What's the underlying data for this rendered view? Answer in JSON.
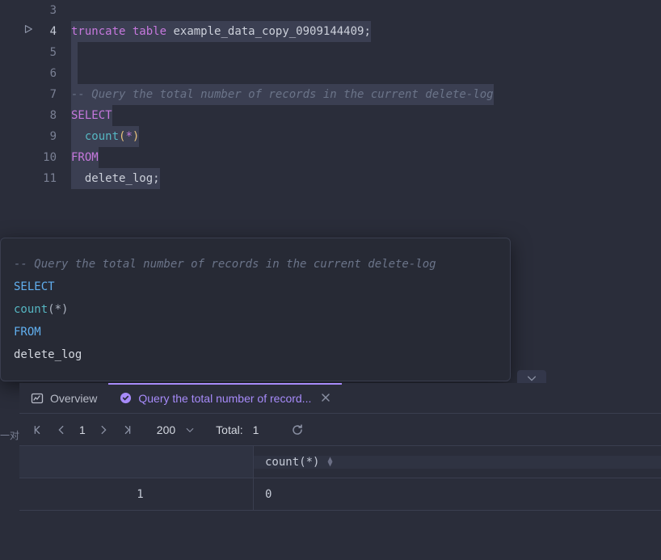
{
  "editor": {
    "lines": [
      {
        "num": "3",
        "active": false,
        "content": ""
      },
      {
        "num": "4",
        "active": true,
        "runnable": true,
        "tokens": [
          {
            "t": "truncate",
            "c": "kw"
          },
          {
            "t": " "
          },
          {
            "t": "table",
            "c": "kw"
          },
          {
            "t": " "
          },
          {
            "t": "example_data_copy_0909144409",
            "c": "ident"
          },
          {
            "t": ";",
            "c": "ident"
          }
        ],
        "hl": true
      },
      {
        "num": "5",
        "active": false,
        "tokens": [
          {
            "t": " "
          }
        ],
        "hl": true
      },
      {
        "num": "6",
        "active": false,
        "tokens": [
          {
            "t": " "
          }
        ],
        "hl": true
      },
      {
        "num": "7",
        "active": false,
        "tokens": [
          {
            "t": "-- Query the total number of records in the current delete-log",
            "c": "comment"
          }
        ],
        "hl": true
      },
      {
        "num": "8",
        "active": false,
        "tokens": [
          {
            "t": "SELECT",
            "c": "kw"
          }
        ],
        "hl": true
      },
      {
        "num": "9",
        "active": false,
        "tokens": [
          {
            "t": "  "
          },
          {
            "t": "count",
            "c": "fn"
          },
          {
            "t": "(",
            "c": "paren"
          },
          {
            "t": "*",
            "c": "star"
          },
          {
            "t": ")",
            "c": "paren"
          }
        ],
        "hl": true
      },
      {
        "num": "10",
        "active": false,
        "tokens": [
          {
            "t": "FROM",
            "c": "kw"
          }
        ],
        "hl": true
      },
      {
        "num": "11",
        "active": false,
        "tokens": [
          {
            "t": "  "
          },
          {
            "t": "delete_log",
            "c": "ident"
          },
          {
            "t": ";",
            "c": "ident"
          }
        ],
        "hl": true
      }
    ]
  },
  "tooltip": {
    "lines": [
      [
        {
          "t": "-- Query the total number of records in the current delete-log",
          "c": "tt-comment"
        }
      ],
      [
        {
          "t": "SELECT",
          "c": "tt-kw"
        }
      ],
      [
        {
          "t": "  "
        },
        {
          "t": "count",
          "c": "tt-fn"
        },
        {
          "t": "(",
          "c": "tt-paren"
        },
        {
          "t": "*",
          "c": "tt-star"
        },
        {
          "t": ")",
          "c": "tt-paren"
        }
      ],
      [
        {
          "t": "FROM",
          "c": "tt-kw"
        }
      ],
      [
        {
          "t": "  "
        },
        {
          "t": "delete_log",
          "c": "tt-ident"
        }
      ]
    ]
  },
  "tabs": {
    "overview": "Overview",
    "active_label": "Query the total number of record..."
  },
  "pager": {
    "page": "1",
    "limit": "200",
    "total_label": "Total:",
    "total_value": "1"
  },
  "table": {
    "header": "count(*)",
    "rows": [
      {
        "idx": "1",
        "val": "0"
      }
    ]
  },
  "side_label": "一对"
}
